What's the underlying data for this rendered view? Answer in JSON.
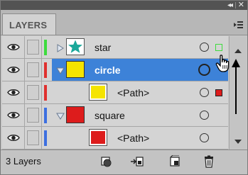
{
  "panel": {
    "collapse_glyph": "◂◂",
    "close_glyph": "✕",
    "tab_label": "LAYERS",
    "footer_count": "3 Layers"
  },
  "colors": {
    "selection_blue": "#3d82d8",
    "layer_green": "#3ddc3d",
    "layer_red": "#e0302e",
    "layer_blue": "#3c6fe0",
    "star_teal": "#1aa89a",
    "yellow": "#f5e400",
    "red_fill": "#dd1c1c"
  },
  "layers": [
    {
      "name": "star",
      "color": "green",
      "expanded": false,
      "selected": false,
      "indent": 0,
      "thumb": "star",
      "selection_square": "outline-green"
    },
    {
      "name": "circle",
      "color": "red",
      "expanded": true,
      "selected": true,
      "indent": 0,
      "thumb": "yellow-square",
      "selection_square": "none"
    },
    {
      "name": "<Path>",
      "color": "red",
      "expanded": false,
      "selected": false,
      "indent": 1,
      "thumb": "yellow-square",
      "selection_square": "filled-red"
    },
    {
      "name": "square",
      "color": "blue",
      "expanded": true,
      "selected": false,
      "indent": 0,
      "thumb": "red-square",
      "selection_square": "none"
    },
    {
      "name": "<Path>",
      "color": "blue",
      "expanded": false,
      "selected": false,
      "indent": 1,
      "thumb": "red-square",
      "selection_square": "none"
    }
  ],
  "footer_tools": [
    {
      "icon": "make-clipping-mask-icon"
    },
    {
      "icon": "create-sublayer-icon"
    },
    {
      "icon": "create-new-layer-icon"
    },
    {
      "icon": "delete-layer-icon"
    }
  ]
}
